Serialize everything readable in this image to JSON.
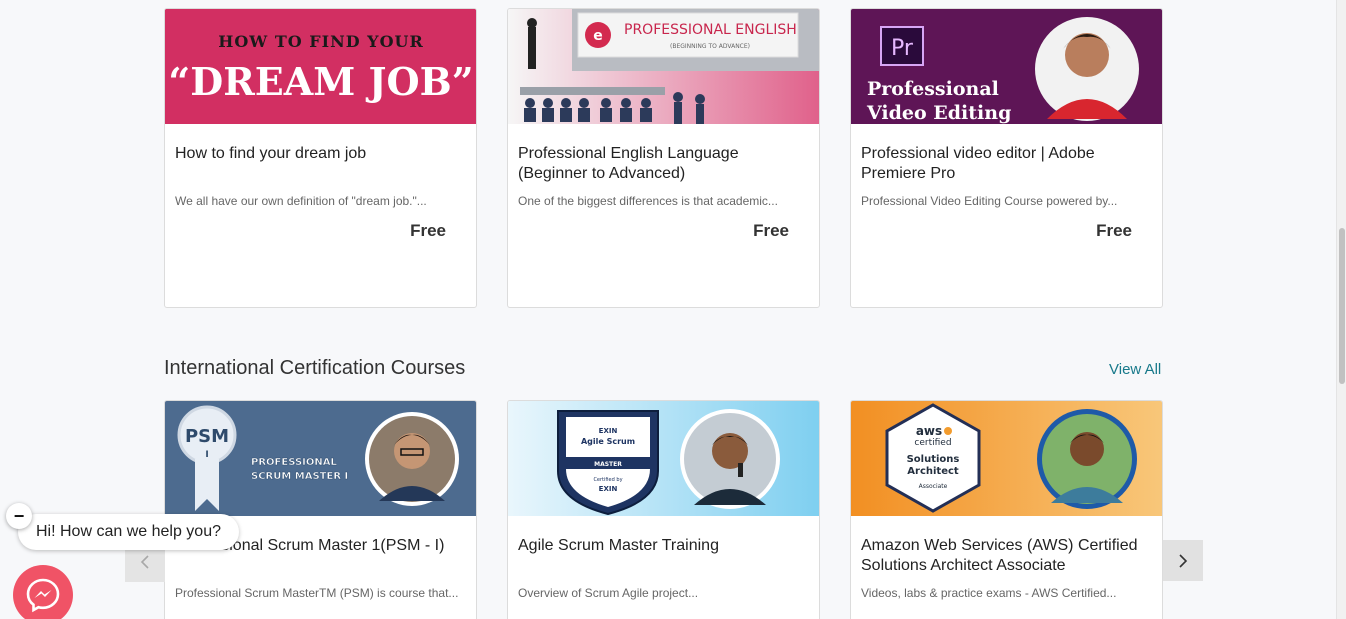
{
  "row1": [
    {
      "title": "How to find your dream job",
      "desc": "We all have our own definition of \"dream job.\"...",
      "price": "Free",
      "thumb_lines": [
        "HOW TO FIND YOUR",
        "“DREAM JOB”"
      ],
      "thumb_color": "#d22f62"
    },
    {
      "title": "Professional English Language (Beginner to Advanced)",
      "desc": "One of the biggest differences is that academic...",
      "price": "Free",
      "thumb_lines": [
        "PROFESSIONAL ENGLISH",
        "(BEGINNING TO ADVANCE)"
      ],
      "thumb_color": "#e25c86"
    },
    {
      "title": "Professional video editor | Adobe Premiere Pro",
      "desc": "Professional Video Editing Course powered by...",
      "price": "Free",
      "thumb_lines": [
        "Pr",
        "Professional",
        "Video Editing"
      ],
      "thumb_color": "#5e1556"
    }
  ],
  "section": {
    "title": "International Certification Courses",
    "view_all": "View All"
  },
  "row2": [
    {
      "title": "Professional Scrum Master 1(PSM - I)",
      "desc": "Professional Scrum MasterTM (PSM) is course that...",
      "thumb_lines": [
        "PSM",
        "I",
        "PROFESSIONAL",
        "SCRUM MASTER I"
      ],
      "thumb_color": "#4d6b8f"
    },
    {
      "title": "Agile Scrum Master Training",
      "desc": "Overview of Scrum Agile project...",
      "thumb_lines": [
        "EXIN",
        "Agile Scrum",
        "MASTER",
        "Certified by",
        "EXIN"
      ],
      "thumb_color": "#8fd3ef"
    },
    {
      "title": "Amazon Web Services (AWS) Certified Solutions Architect Associate",
      "desc": "Videos, labs & practice exams - AWS Certified...",
      "thumb_lines": [
        "aws",
        "certified",
        "Solutions",
        "Architect",
        "Associate"
      ],
      "thumb_color": "#f39c2e"
    }
  ],
  "chat": {
    "greeting": "Hi! How can we help you?",
    "close_label": "−"
  },
  "icons": {
    "prev": "chevron-left-icon",
    "next": "chevron-right-icon",
    "messenger": "messenger-icon"
  },
  "colors": {
    "accent": "#17798a",
    "messenger": "#f05366"
  }
}
